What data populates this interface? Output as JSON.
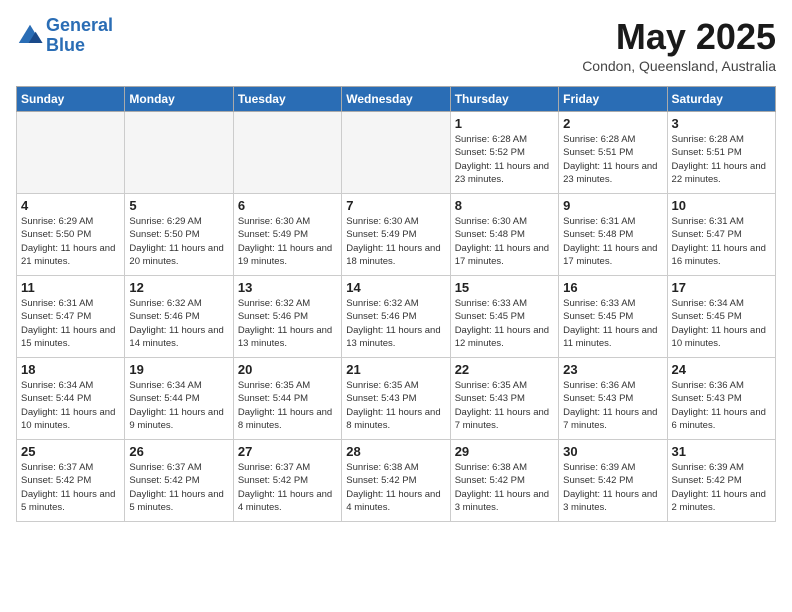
{
  "header": {
    "logo_line1": "General",
    "logo_line2": "Blue",
    "month": "May 2025",
    "location": "Condon, Queensland, Australia"
  },
  "weekdays": [
    "Sunday",
    "Monday",
    "Tuesday",
    "Wednesday",
    "Thursday",
    "Friday",
    "Saturday"
  ],
  "weeks": [
    [
      {
        "day": "",
        "info": ""
      },
      {
        "day": "",
        "info": ""
      },
      {
        "day": "",
        "info": ""
      },
      {
        "day": "",
        "info": ""
      },
      {
        "day": "1",
        "info": "Sunrise: 6:28 AM\nSunset: 5:52 PM\nDaylight: 11 hours and 23 minutes."
      },
      {
        "day": "2",
        "info": "Sunrise: 6:28 AM\nSunset: 5:51 PM\nDaylight: 11 hours and 23 minutes."
      },
      {
        "day": "3",
        "info": "Sunrise: 6:28 AM\nSunset: 5:51 PM\nDaylight: 11 hours and 22 minutes."
      }
    ],
    [
      {
        "day": "4",
        "info": "Sunrise: 6:29 AM\nSunset: 5:50 PM\nDaylight: 11 hours and 21 minutes."
      },
      {
        "day": "5",
        "info": "Sunrise: 6:29 AM\nSunset: 5:50 PM\nDaylight: 11 hours and 20 minutes."
      },
      {
        "day": "6",
        "info": "Sunrise: 6:30 AM\nSunset: 5:49 PM\nDaylight: 11 hours and 19 minutes."
      },
      {
        "day": "7",
        "info": "Sunrise: 6:30 AM\nSunset: 5:49 PM\nDaylight: 11 hours and 18 minutes."
      },
      {
        "day": "8",
        "info": "Sunrise: 6:30 AM\nSunset: 5:48 PM\nDaylight: 11 hours and 17 minutes."
      },
      {
        "day": "9",
        "info": "Sunrise: 6:31 AM\nSunset: 5:48 PM\nDaylight: 11 hours and 17 minutes."
      },
      {
        "day": "10",
        "info": "Sunrise: 6:31 AM\nSunset: 5:47 PM\nDaylight: 11 hours and 16 minutes."
      }
    ],
    [
      {
        "day": "11",
        "info": "Sunrise: 6:31 AM\nSunset: 5:47 PM\nDaylight: 11 hours and 15 minutes."
      },
      {
        "day": "12",
        "info": "Sunrise: 6:32 AM\nSunset: 5:46 PM\nDaylight: 11 hours and 14 minutes."
      },
      {
        "day": "13",
        "info": "Sunrise: 6:32 AM\nSunset: 5:46 PM\nDaylight: 11 hours and 13 minutes."
      },
      {
        "day": "14",
        "info": "Sunrise: 6:32 AM\nSunset: 5:46 PM\nDaylight: 11 hours and 13 minutes."
      },
      {
        "day": "15",
        "info": "Sunrise: 6:33 AM\nSunset: 5:45 PM\nDaylight: 11 hours and 12 minutes."
      },
      {
        "day": "16",
        "info": "Sunrise: 6:33 AM\nSunset: 5:45 PM\nDaylight: 11 hours and 11 minutes."
      },
      {
        "day": "17",
        "info": "Sunrise: 6:34 AM\nSunset: 5:45 PM\nDaylight: 11 hours and 10 minutes."
      }
    ],
    [
      {
        "day": "18",
        "info": "Sunrise: 6:34 AM\nSunset: 5:44 PM\nDaylight: 11 hours and 10 minutes."
      },
      {
        "day": "19",
        "info": "Sunrise: 6:34 AM\nSunset: 5:44 PM\nDaylight: 11 hours and 9 minutes."
      },
      {
        "day": "20",
        "info": "Sunrise: 6:35 AM\nSunset: 5:44 PM\nDaylight: 11 hours and 8 minutes."
      },
      {
        "day": "21",
        "info": "Sunrise: 6:35 AM\nSunset: 5:43 PM\nDaylight: 11 hours and 8 minutes."
      },
      {
        "day": "22",
        "info": "Sunrise: 6:35 AM\nSunset: 5:43 PM\nDaylight: 11 hours and 7 minutes."
      },
      {
        "day": "23",
        "info": "Sunrise: 6:36 AM\nSunset: 5:43 PM\nDaylight: 11 hours and 7 minutes."
      },
      {
        "day": "24",
        "info": "Sunrise: 6:36 AM\nSunset: 5:43 PM\nDaylight: 11 hours and 6 minutes."
      }
    ],
    [
      {
        "day": "25",
        "info": "Sunrise: 6:37 AM\nSunset: 5:42 PM\nDaylight: 11 hours and 5 minutes."
      },
      {
        "day": "26",
        "info": "Sunrise: 6:37 AM\nSunset: 5:42 PM\nDaylight: 11 hours and 5 minutes."
      },
      {
        "day": "27",
        "info": "Sunrise: 6:37 AM\nSunset: 5:42 PM\nDaylight: 11 hours and 4 minutes."
      },
      {
        "day": "28",
        "info": "Sunrise: 6:38 AM\nSunset: 5:42 PM\nDaylight: 11 hours and 4 minutes."
      },
      {
        "day": "29",
        "info": "Sunrise: 6:38 AM\nSunset: 5:42 PM\nDaylight: 11 hours and 3 minutes."
      },
      {
        "day": "30",
        "info": "Sunrise: 6:39 AM\nSunset: 5:42 PM\nDaylight: 11 hours and 3 minutes."
      },
      {
        "day": "31",
        "info": "Sunrise: 6:39 AM\nSunset: 5:42 PM\nDaylight: 11 hours and 2 minutes."
      }
    ]
  ]
}
